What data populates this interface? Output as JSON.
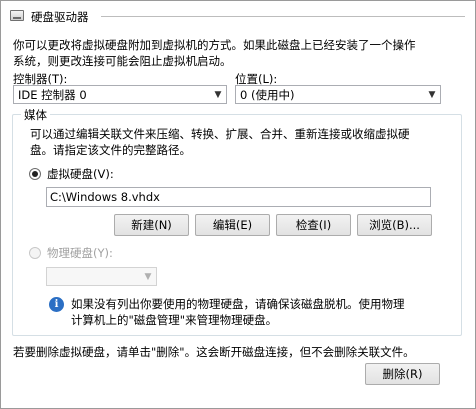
{
  "header": {
    "title": "硬盘驱动器",
    "icon": "hard-drive-icon"
  },
  "intro": {
    "line1": "你可以更改将虚拟硬盘附加到虚拟机的方式。如果此磁盘上已经安装了一个操作",
    "line2": "系统，则更改连接可能会阻止虚拟机启动。"
  },
  "controller": {
    "label": "控制器(T):",
    "value": "IDE 控制器 0"
  },
  "location": {
    "label": "位置(L):",
    "value": "0 (使用中)"
  },
  "media": {
    "label": "媒体",
    "desc_line1": "可以通过编辑关联文件来压缩、转换、扩展、合并、重新连接或收缩虚拟硬",
    "desc_line2": "盘。请指定该文件的完整路径。",
    "virtual_disk": {
      "label": "虚拟硬盘(V):",
      "selected": true,
      "path": "C:\\Windows 8.vhdx"
    },
    "buttons": {
      "new": "新建(N)",
      "edit": "编辑(E)",
      "inspect": "检查(I)",
      "browse": "浏览(B)..."
    },
    "physical_disk": {
      "label": "物理硬盘(Y):",
      "selected": false,
      "enabled": false,
      "value": ""
    },
    "info": {
      "icon": "info-icon",
      "line1": "如果没有列出你要使用的物理硬盘，请确保该磁盘脱机。使用物理",
      "line2": "计算机上的\"磁盘管理\"来管理物理硬盘。"
    }
  },
  "footer": {
    "remove_text": "若要删除虚拟硬盘，请单击\"删除\"。这会断开磁盘连接，但不会删除关联文件。",
    "remove_button": "删除(R)"
  },
  "colors": {
    "info_blue": "#2b6fc4",
    "disabled_text": "#a0a0a0",
    "border": "#abadb3"
  }
}
